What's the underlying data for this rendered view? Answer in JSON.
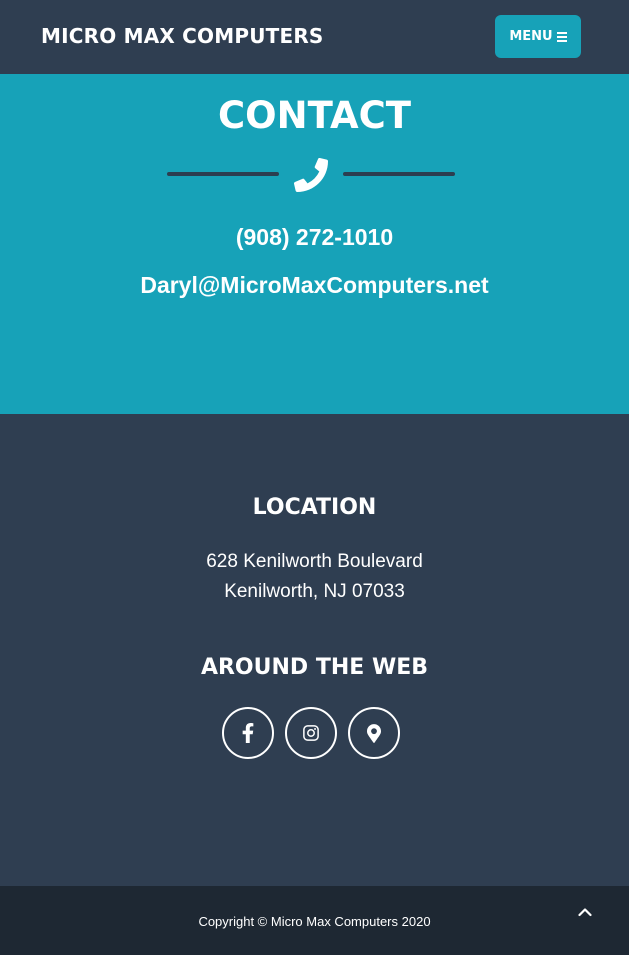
{
  "nav": {
    "brand": "MICRO MAX COMPUTERS",
    "menu_label": "MENU",
    "menu_icon": "bars-icon"
  },
  "contact": {
    "title": "CONTACT",
    "divider_icon": "phone-icon",
    "phone": "(908) 272-1010",
    "email": "Daryl@MicroMaxComputers.net"
  },
  "footer": {
    "location_title": "LOCATION",
    "address_line1": "628 Kenilworth Boulevard",
    "address_line2": "Kenilworth, NJ 07033",
    "web_title": "AROUND THE WEB",
    "social": [
      {
        "icon": "facebook-icon"
      },
      {
        "icon": "instagram-icon"
      },
      {
        "icon": "map-marker-icon"
      }
    ]
  },
  "copyright": {
    "text": "Copyright © Micro Max Computers 2020",
    "scroll_top_icon": "chevron-up-icon"
  },
  "colors": {
    "nav_bg": "#2f3e51",
    "accent": "#17a2b8",
    "footer_bg": "#2f3e51",
    "copyright_bg": "#1e2833",
    "text": "#ffffff"
  }
}
